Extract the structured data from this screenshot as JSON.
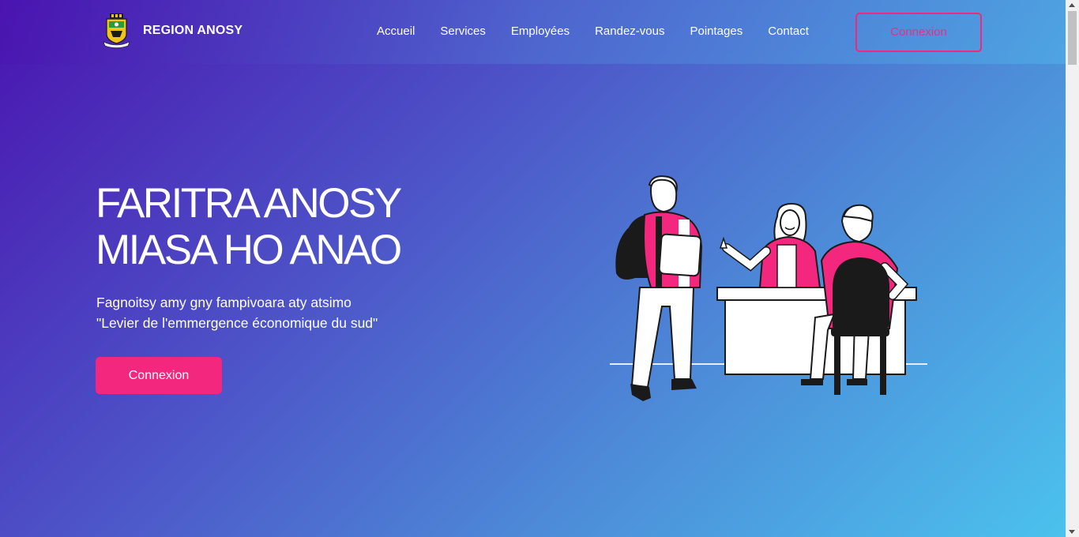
{
  "brand": {
    "name": "REGION ANOSY",
    "logo": "region-coat-of-arms"
  },
  "nav": {
    "links": [
      "Accueil",
      "Services",
      "Employées",
      "Randez-vous",
      "Pointages",
      "Contact"
    ],
    "login_button": "Connexion"
  },
  "hero": {
    "title_line1": "FARITRA ANOSY",
    "title_line2": "MIASA HO ANAO",
    "subtitle_line1": "Fagnoitsy amy gny fampivoara aty atsimo",
    "subtitle_line2": "\"Levier de l'emmergence économique du sud\"",
    "cta_button": "Connexion",
    "illustration": "office-meeting-illustration"
  },
  "colors": {
    "accent": "#f2277d",
    "gradient_start": "#4a14b0",
    "gradient_end": "#4bc3ee"
  }
}
